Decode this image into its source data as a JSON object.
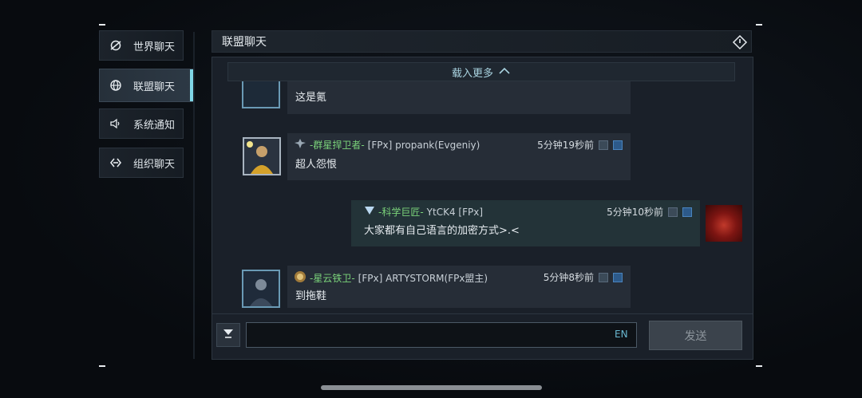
{
  "sidebar": {
    "items": [
      {
        "label": "世界聊天",
        "icon": "globe-swirl-icon"
      },
      {
        "label": "联盟聊天",
        "icon": "globe-icon",
        "active": true
      },
      {
        "label": "系统通知",
        "icon": "speaker-icon"
      },
      {
        "label": "组织聊天",
        "icon": "link-diamond-icon"
      }
    ]
  },
  "header": {
    "title": "联盟聊天",
    "exit_icon": "exit-icon"
  },
  "load_more": {
    "label": "载入更多",
    "icon": "chevron-up-icon"
  },
  "messages": [
    {
      "text": "这是氪"
    },
    {
      "guild": "-群星捍卫者-",
      "name": "[FPx] propank(Evgeniy)",
      "time": "5分钟19秒前",
      "text": "超人怨恨"
    },
    {
      "guild": "-科学巨匠-",
      "name": "YtCK4 [FPx]",
      "time": "5分钟10秒前",
      "text": "大家都有自己语言的加密方式>.<"
    },
    {
      "guild": "-星云铁卫-",
      "name": "[FPx] ARTYSTORM(FPx盟主)",
      "time": "5分钟8秒前",
      "text": "到拖鞋"
    }
  ],
  "input": {
    "value": "",
    "lang": "EN"
  },
  "send_label": "发送",
  "colors": {
    "accent": "#7fd6e6",
    "guild": "#7bd37a"
  }
}
